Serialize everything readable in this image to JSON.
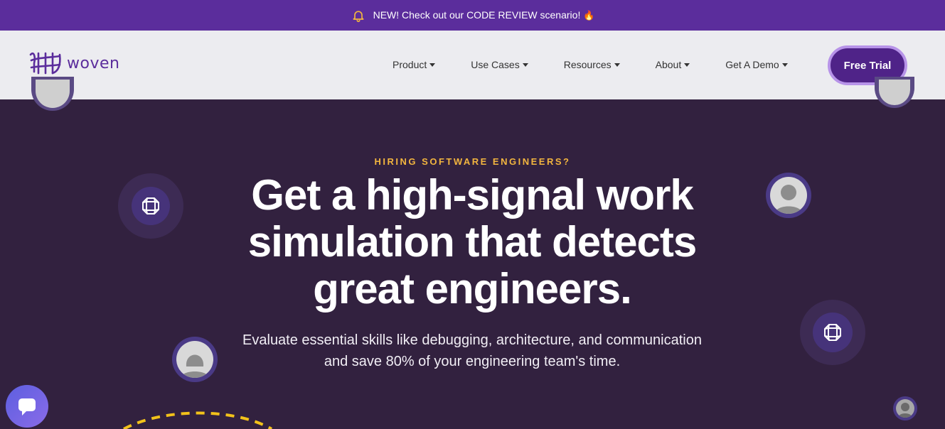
{
  "announcement": {
    "text": "NEW! Check out our CODE REVIEW scenario!",
    "emoji": "🔥",
    "icon": "bell-icon"
  },
  "brand": {
    "name": "woven",
    "color": "#5b2d9c"
  },
  "nav": {
    "items": [
      {
        "label": "Product"
      },
      {
        "label": "Use Cases"
      },
      {
        "label": "Resources"
      },
      {
        "label": "About"
      },
      {
        "label": "Get A Demo"
      }
    ],
    "cta": "Free Trial"
  },
  "hero": {
    "eyebrow": "HIRING SOFTWARE ENGINEERS?",
    "headline": "Get a high-signal work simulation that detects great engineers.",
    "subheadline": "Evaluate essential skills like debugging, architecture, and communication and save 80% of your engineering team's time."
  },
  "colors": {
    "accent": "#5b2d9c",
    "hero_bg": "#32213f",
    "eyebrow": "#f2b53f",
    "cta_border": "#b793e8"
  },
  "icons": [
    "bell-icon",
    "gem-icon",
    "avatar-icon",
    "chat-icon"
  ]
}
